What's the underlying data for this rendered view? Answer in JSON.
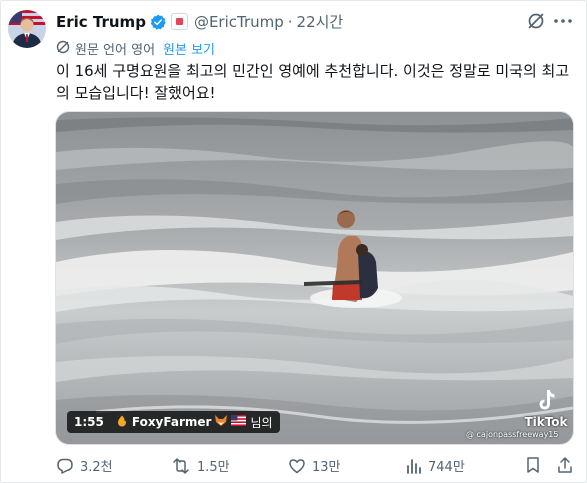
{
  "author": {
    "name": "Eric Trump",
    "handle": "@EricTrump",
    "separator": "·",
    "time": "22시간"
  },
  "translate": {
    "label": "원문 언어 영어",
    "link": "원본 보기"
  },
  "text": "이 16세 구명요원을 최고의 민간인 영예에 추천합니다. 이것은 정말로 미국의 최고의 모습입니다! 잘했어요!",
  "video": {
    "duration": "1:55",
    "username": "FoxyFarmer",
    "suffix": "님의",
    "watermark_label": "TikTok",
    "watermark_handle": "@ cajonpassfreeway15"
  },
  "actions": {
    "replies": "3.2천",
    "reposts": "1.5만",
    "likes": "13만",
    "views": "744만"
  },
  "colors": {
    "accent": "#1d9bf0",
    "muted": "#536471",
    "text": "#0f1419"
  }
}
